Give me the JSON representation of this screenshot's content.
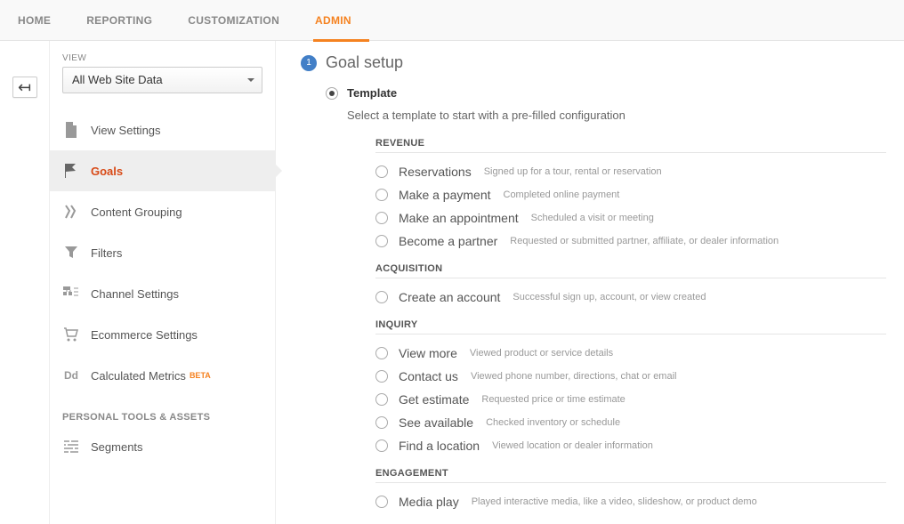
{
  "nav": {
    "tabs": [
      {
        "label": "HOME"
      },
      {
        "label": "REPORTING"
      },
      {
        "label": "CUSTOMIZATION"
      },
      {
        "label": "ADMIN"
      }
    ],
    "active_index": 3
  },
  "sidebar": {
    "view_label": "VIEW",
    "view_select": "All Web Site Data",
    "items": [
      {
        "label": "View Settings"
      },
      {
        "label": "Goals"
      },
      {
        "label": "Content Grouping"
      },
      {
        "label": "Filters"
      },
      {
        "label": "Channel Settings"
      },
      {
        "label": "Ecommerce Settings"
      },
      {
        "label": "Calculated Metrics",
        "beta": "BETA"
      }
    ],
    "section_label": "PERSONAL TOOLS & ASSETS",
    "tools": [
      {
        "label": "Segments"
      }
    ]
  },
  "main": {
    "step_number": "1",
    "step_title": "Goal setup",
    "template_label": "Template",
    "template_hint": "Select a template to start with a pre-filled configuration",
    "groups": [
      {
        "title": "REVENUE",
        "options": [
          {
            "label": "Reservations",
            "desc": "Signed up for a tour, rental or reservation"
          },
          {
            "label": "Make a payment",
            "desc": "Completed online payment"
          },
          {
            "label": "Make an appointment",
            "desc": "Scheduled a visit or meeting"
          },
          {
            "label": "Become a partner",
            "desc": "Requested or submitted partner, affiliate, or dealer information"
          }
        ]
      },
      {
        "title": "ACQUISITION",
        "options": [
          {
            "label": "Create an account",
            "desc": "Successful sign up, account, or view created"
          }
        ]
      },
      {
        "title": "INQUIRY",
        "options": [
          {
            "label": "View more",
            "desc": "Viewed product or service details"
          },
          {
            "label": "Contact us",
            "desc": "Viewed phone number, directions, chat or email"
          },
          {
            "label": "Get estimate",
            "desc": "Requested price or time estimate"
          },
          {
            "label": "See available",
            "desc": "Checked inventory or schedule"
          },
          {
            "label": "Find a location",
            "desc": "Viewed location or dealer information"
          }
        ]
      },
      {
        "title": "ENGAGEMENT",
        "options": [
          {
            "label": "Media play",
            "desc": "Played interactive media, like a video, slideshow, or product demo"
          }
        ]
      }
    ]
  }
}
